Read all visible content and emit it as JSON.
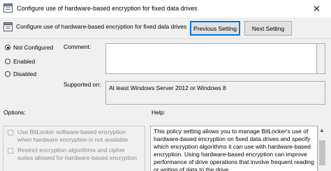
{
  "window": {
    "title": "Configure use of hardware-based encryption for fixed data drives",
    "close_glyph": "✕"
  },
  "header": {
    "title": "Configure use of hardware-based encryption for fixed data drives",
    "prev_label": "Previous Setting",
    "next_label": "Next Setting"
  },
  "state": {
    "options": [
      {
        "label": "Not Configured",
        "checked": true
      },
      {
        "label": "Enabled",
        "checked": false
      },
      {
        "label": "Disabled",
        "checked": false
      }
    ]
  },
  "comment": {
    "label": "Comment:",
    "value": ""
  },
  "supported": {
    "label": "Supported on:",
    "value": "At least Windows Server 2012 or Windows 8"
  },
  "options_section": {
    "label": "Options:",
    "items": [
      {
        "label": "Use BitLocker software-based encryption when hardware encryption is not available",
        "checked": false
      },
      {
        "label": "Restrict encryption algorithms and cipher suites allowed for hardware-based encryption",
        "checked": false
      }
    ]
  },
  "help_section": {
    "label": "Help:",
    "text": "This policy setting allows you to manage BitLocker's use of hardware-based encryption on fixed data drives and specify which encryption algorithms it can use with hardware-based encryption. Using hardware-based encryption can improve performance of drive operations that involve frequent reading or writing of data to the drive."
  },
  "icons": {
    "app": "policy-icon",
    "header": "policy-icon",
    "close": "close-icon",
    "scroll_up": "scroll-up-arrow-icon"
  },
  "colors": {
    "focus_border": "#0078d7",
    "disabled_text": "#8a8a8a"
  }
}
